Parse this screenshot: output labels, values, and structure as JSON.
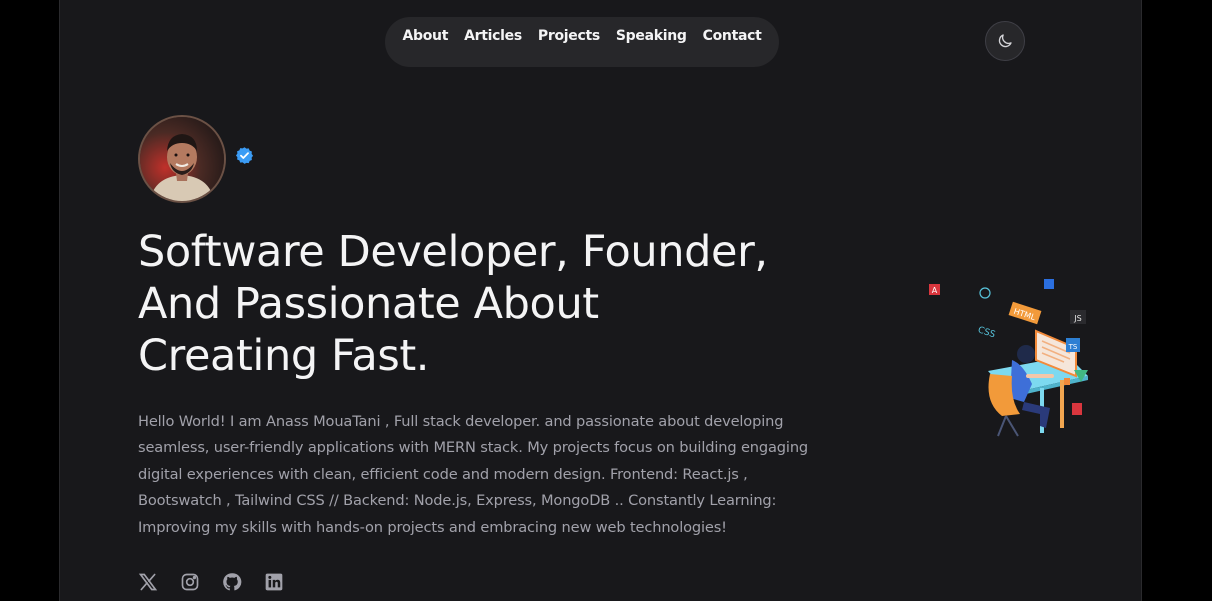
{
  "nav": {
    "items": [
      {
        "label": "About"
      },
      {
        "label": "Articles"
      },
      {
        "label": "Projects"
      },
      {
        "label": "Speaking"
      },
      {
        "label": "Contact"
      }
    ]
  },
  "theme_toggle": {
    "icon": "moon-icon"
  },
  "profile": {
    "verified_icon": "verified-badge-icon",
    "avatar_icon": "avatar-photo"
  },
  "hero": {
    "headline_line1": "Software Developer, Founder,",
    "headline_line2": "And Passionate About",
    "headline_line3": "Creating Fast.",
    "bio": "Hello World! I am Anass MouaTani , Full stack developer. and passionate about developing seamless, user-friendly applications with MERN stack. My projects focus on building engaging digital experiences with clean, efficient code and modern design. Frontend: React.js , Bootswatch , Tailwind CSS // Backend: Node.js, Express, MongoDB .. Constantly Learning: Improving my skills with hands-on projects and embracing new web technologies!"
  },
  "illustration": {
    "labels": [
      "HTML",
      "CSS",
      "JS",
      "TS"
    ]
  },
  "social": {
    "icons": [
      "x-icon",
      "instagram-icon",
      "github-icon",
      "linkedin-icon"
    ]
  },
  "colors": {
    "background": "#18181b",
    "outer": "#000000",
    "nav_bg": "#27272a",
    "text": "#f4f4f5",
    "muted": "#a1a1aa",
    "verified": "#3b9cf5"
  }
}
